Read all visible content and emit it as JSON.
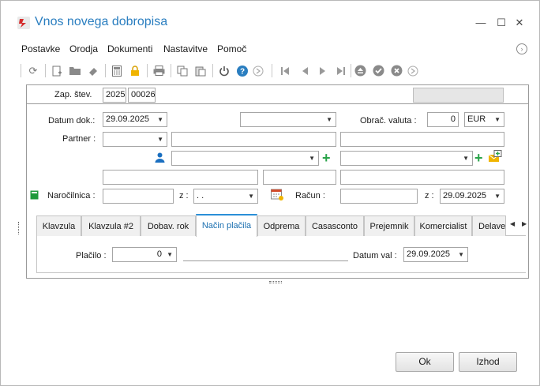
{
  "window": {
    "title": "Vnos novega dobropisa",
    "buttons": {
      "minimize": "—",
      "maximize": "☐",
      "close": "✕"
    }
  },
  "menu": {
    "items": [
      "Postavke",
      "Orodja",
      "Dokumenti",
      "Nastavitve",
      "Pomoč"
    ]
  },
  "toolbar": {
    "icons": [
      "refresh-icon",
      "new-document-icon",
      "open-folder-icon",
      "eraser-icon",
      "calculator-icon",
      "lock-icon",
      "print-icon",
      "copy-icon",
      "paste-icon",
      "power-icon",
      "help-icon",
      "forward-circle-icon",
      "first-record-icon",
      "previous-record-icon",
      "next-record-icon",
      "last-record-icon",
      "eject-icon",
      "confirm-icon",
      "cancel-icon",
      "forward-circle-icon"
    ]
  },
  "header": {
    "zap_label": "Zap. štev.",
    "zap_year": "2025",
    "zap_number": "00026",
    "right_field": ""
  },
  "form": {
    "datum_label": "Datum dok.:",
    "datum_value": "29.09.2025",
    "doc_type_value": "",
    "valuta_label": "Obrač. valuta :",
    "valuta_rate": "0",
    "valuta_currency": "EUR",
    "partner_label": "Partner :",
    "partner_code": "",
    "partner_name": "",
    "partner_extra": "",
    "contact_value": "",
    "contact2_value": "",
    "row4_a": "",
    "row4_b": "",
    "row4_c": "",
    "narocilnica_label": "Naročilnica :",
    "narocilnica_value": "",
    "z_label": "z :",
    "z_date_value": " .  .",
    "racun_label": "Račun :",
    "racun_value": "",
    "z2_label": "z :",
    "z2_date_value": "29.09.2025"
  },
  "tabs": {
    "items": [
      "Klavzula",
      "Klavzula #2",
      "Dobav. rok",
      "Način plačila",
      "Odprema",
      "Casasconto",
      "Prejemnik",
      "Komercialist",
      "Delave"
    ],
    "active": "Način plačila"
  },
  "payment": {
    "placilo_label": "Plačilo :",
    "placilo_value": "0",
    "placilo_desc": "",
    "datum_val_label": "Datum val :",
    "datum_val_value": "29.09.2025"
  },
  "buttons": {
    "ok": "Ok",
    "exit": "Izhod"
  },
  "colors": {
    "title": "#2a7ec0",
    "active_tab": "#2a8fd8",
    "add": "#2aa44a"
  }
}
